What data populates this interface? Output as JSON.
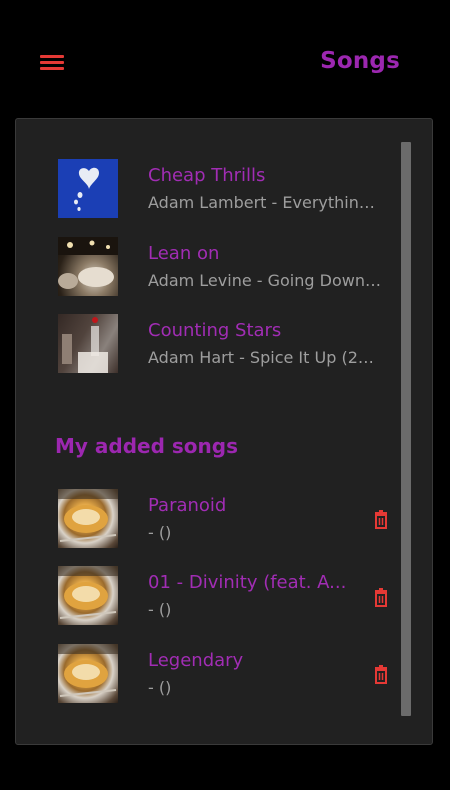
{
  "header": {
    "title": "Songs"
  },
  "top_songs": [
    {
      "title": "Cheap Thrills",
      "subtitle": "Adam Lambert - Everything (...",
      "art": "heart-art"
    },
    {
      "title": "Lean on",
      "subtitle": "Adam Levine - Going Down (...",
      "art": "dining-art"
    },
    {
      "title": "Counting Stars",
      "subtitle": "Adam Hart - Spice It Up (201...",
      "art": "glass-art"
    }
  ],
  "added_section": {
    "title": "My added songs",
    "songs": [
      {
        "title": "Paranoid",
        "subtitle": "- ()",
        "art": "plate-art"
      },
      {
        "title": "01 - Divinity (feat. A...",
        "subtitle": "- ()",
        "art": "plate-art"
      },
      {
        "title": "Legendary",
        "subtitle": "- ()",
        "art": "plate-art"
      }
    ]
  },
  "colors": {
    "accent": "#9c27b0",
    "icon_red": "#e53935",
    "background": "#000000",
    "card": "#212121",
    "subtitle": "#9e9e9e"
  },
  "icons": {
    "menu": "hamburger-menu-icon",
    "delete": "trash-icon"
  }
}
